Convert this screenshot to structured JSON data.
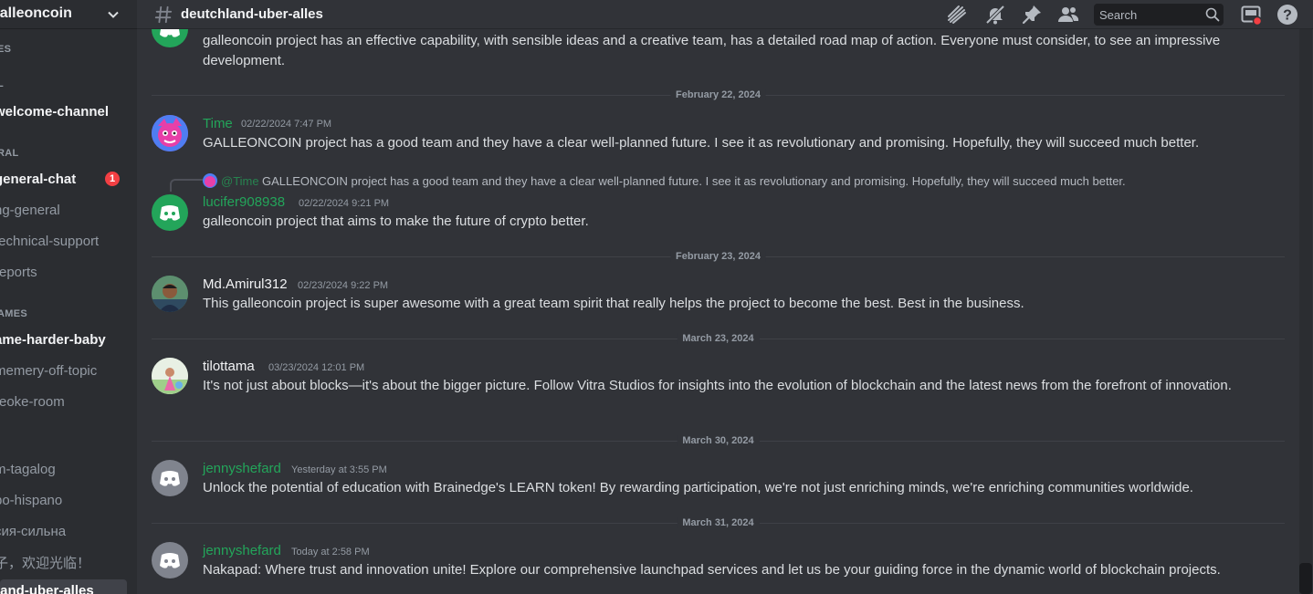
{
  "sidebar": {
    "server_name": "galleoncoin",
    "categories": {
      "c1": "ES",
      "c2": "L",
      "c3": "RAL",
      "c4": "AMES"
    },
    "channels": {
      "welcome": "welcome-channel",
      "general_chat": "general-chat",
      "general_lang": "ng-general",
      "tech_support": "technical-support",
      "reports": "reports",
      "harder": "ame-harder-baby",
      "offtopic": "memery-off-topic",
      "karaoke": "reoke-room",
      "tagalog": "m-tagalog",
      "hispano": "po-hispano",
      "russian": "сия-сильна",
      "chinese": "子，欢迎光临！",
      "active": "land-uber-alles"
    },
    "general_chat_badge": "1"
  },
  "header": {
    "channel_name": "deutchland-uber-alles",
    "search_placeholder": "Search",
    "icons": [
      "threads-icon",
      "mute-bell-icon",
      "pin-icon",
      "members-icon",
      "search-icon",
      "inbox-icon",
      "help-icon"
    ]
  },
  "messages": {
    "m0": {
      "text": "galleoncoin project has an effective capability, with sensible ideas and a creative team, has a detailed road map of action. Everyone must consider, to see an impressive development."
    },
    "d1": "February 22, 2024",
    "m1": {
      "author": "Time",
      "timestamp": "02/22/2024 7:47 PM",
      "text": "GALLEONCOIN project has a good team and they have a clear well-planned future. I see it as revolutionary and promising. Hopefully, they will succeed much better."
    },
    "m2": {
      "reply_author": "@Time",
      "reply_text": "GALLEONCOIN project has a good team and they have a clear well-planned future. I see it as revolutionary and promising. Hopefully, they will succeed much better.",
      "author": "lucifer908938",
      "timestamp": "02/22/2024 9:21 PM",
      "text": "galleoncoin project that aims to make the future of crypto better."
    },
    "d2": "February 23, 2024",
    "m3": {
      "author": "Md.Amirul312",
      "timestamp": "02/23/2024 9:22 PM",
      "text": "This galleoncoin project is super awesome with a great team spirit that really helps the project to become the best. Best in the business."
    },
    "d3": "March 23, 2024",
    "m4": {
      "author": "tilottama",
      "timestamp": "03/23/2024 12:01 PM",
      "text": "It's not just about blocks—it's about the bigger picture. Follow Vitra Studios for insights into the evolution of blockchain and the latest news from the forefront of innovation."
    },
    "d4": "March 30, 2024",
    "m5": {
      "author": "jennyshefard",
      "timestamp": "Yesterday at 3:55 PM",
      "text": "Unlock the potential of education with Brainedge's LEARN token! By rewarding participation, we're not just enriching minds, we're enriching communities worldwide."
    },
    "d5": "March 31, 2024",
    "m6": {
      "author": "jennyshefard",
      "timestamp": "Today at 2:58 PM",
      "text": "Nakapad: Where trust and innovation unite! Explore our comprehensive launchpad services and let us be your guiding force in the dynamic world of blockchain projects."
    }
  },
  "colors": {
    "green_name": "#23a55a",
    "white_name": "#f2f3f5",
    "discord_blurple": "#5865f2",
    "badge_red": "#f23f43"
  }
}
